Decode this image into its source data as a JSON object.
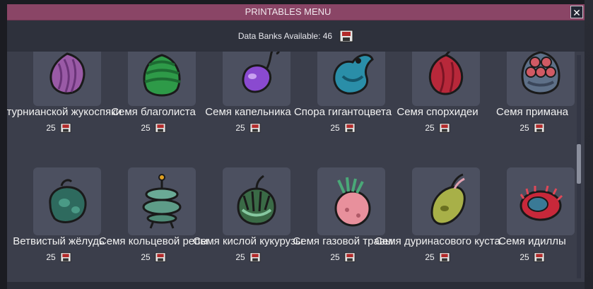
{
  "window": {
    "title": "PRINTABLES MENU",
    "close_label": "✕"
  },
  "header": {
    "data_banks_text": "Data Banks Available: 46",
    "icon": "databank-icon"
  },
  "items": [
    {
      "label": "сатурнианской жукоспяки",
      "cost": "25",
      "icon": "saturnian-seed-icon"
    },
    {
      "label": "Семя благолиста",
      "cost": "25",
      "icon": "balm-lily-seed-icon"
    },
    {
      "label": "Семя капельника",
      "cost": "25",
      "icon": "drip-seed-icon"
    },
    {
      "label": "Спора гигантоцвета",
      "cost": "25",
      "icon": "giant-spore-icon"
    },
    {
      "label": "Семя спорхидеи",
      "cost": "25",
      "icon": "sporechid-seed-icon"
    },
    {
      "label": "Семя примана",
      "cost": "25",
      "icon": "lure-seed-icon"
    },
    {
      "label": "Ветвистый жёлудь",
      "cost": "25",
      "icon": "branch-acorn-icon"
    },
    {
      "label": "Семя кольцевой репы",
      "cost": "25",
      "icon": "ring-turnip-seed-icon"
    },
    {
      "label": "Семя кислой кукурузы",
      "cost": "25",
      "icon": "sour-corn-seed-icon"
    },
    {
      "label": "Семя газовой травы",
      "cost": "25",
      "icon": "gas-grass-seed-icon"
    },
    {
      "label": "Семя дуринасового куста",
      "cost": "25",
      "icon": "durian-bush-seed-icon"
    },
    {
      "label": "Семя идиллы",
      "cost": "25",
      "icon": "idyll-seed-icon"
    }
  ],
  "colors": {
    "titlebar": "#8a4566",
    "panel": "#3b3e4b",
    "tile": "#4c5060"
  }
}
